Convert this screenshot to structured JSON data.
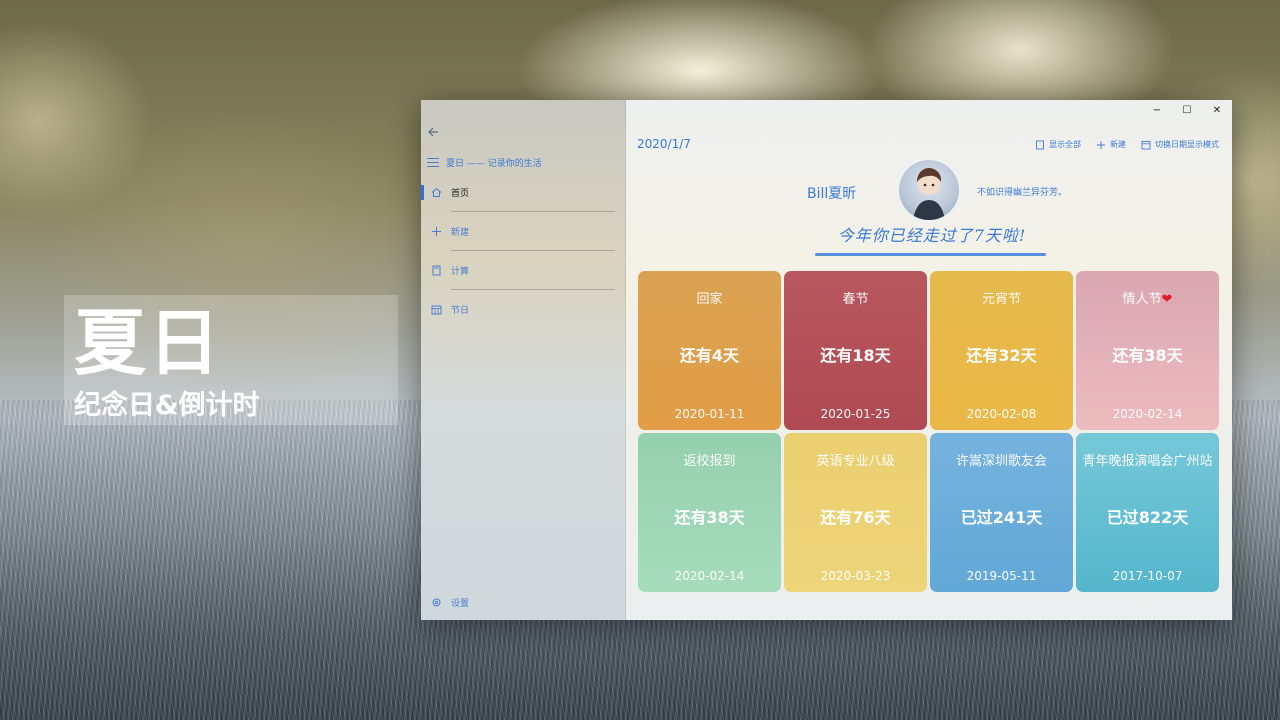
{
  "hero": {
    "title": "夏日",
    "subtitle": "纪念日&倒计时"
  },
  "sidebar": {
    "brand": "夏日 —— 记录你的生活",
    "items": [
      {
        "label": "首页",
        "icon": "home-icon",
        "active": true
      },
      {
        "label": "新建",
        "icon": "plus-icon",
        "active": false
      },
      {
        "label": "计算",
        "icon": "calculator-icon",
        "active": false
      },
      {
        "label": "节日",
        "icon": "calendar-icon",
        "active": false
      }
    ],
    "settings": "设置"
  },
  "main": {
    "date": "2020/1/7",
    "toolbar": {
      "show_all": "显示全部",
      "new": "新建",
      "toggle_mode": "切换日期显示模式"
    },
    "profile": {
      "name": "Bill夏昕",
      "motto": "不如识得幽兰异芬芳。",
      "progress": "今年你已经走过了7天啦!"
    },
    "cards": [
      {
        "title": "回家",
        "count": "还有4天",
        "date": "2020-01-11",
        "color_top": "#d9a252",
        "color_bottom": "#e29d46"
      },
      {
        "title": "春节",
        "count": "还有18天",
        "date": "2020-01-25",
        "color_top": "#b8575e",
        "color_bottom": "#b04a52"
      },
      {
        "title": "元宵节",
        "count": "还有32天",
        "date": "2020-02-08",
        "color_top": "#e6b94d",
        "color_bottom": "#eab845"
      },
      {
        "title": "情人节",
        "count": "还有38天",
        "date": "2020-02-14",
        "color_top": "#d9a6b2",
        "color_bottom": "#edbcbe",
        "heart": true
      },
      {
        "title": "返校报到",
        "count": "还有38天",
        "date": "2020-02-14",
        "color_top": "#95d0ae",
        "color_bottom": "#a6dcbc"
      },
      {
        "title": "英语专业八级",
        "count": "还有76天",
        "date": "2020-03-23",
        "color_top": "#e9cf6f",
        "color_bottom": "#efd57a"
      },
      {
        "title": "许嵩深圳歌友会",
        "count": "已过241天",
        "date": "2019-05-11",
        "color_top": "#75b3de",
        "color_bottom": "#62a8d6"
      },
      {
        "title": "青年晚报演唱会广州站",
        "count": "已过822天",
        "date": "2017-10-07",
        "color_top": "#76c8d8",
        "color_bottom": "#54b6cc"
      }
    ]
  },
  "window": {
    "minimize": "−",
    "maximize": "☐",
    "close": "✕"
  }
}
